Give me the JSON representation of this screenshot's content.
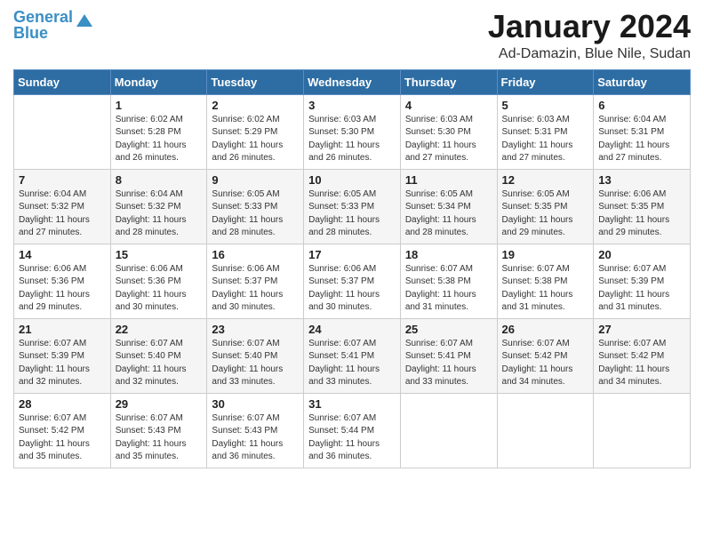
{
  "logo": {
    "line1": "General",
    "line2": "Blue"
  },
  "header": {
    "month": "January 2024",
    "location": "Ad-Damazin, Blue Nile, Sudan"
  },
  "weekdays": [
    "Sunday",
    "Monday",
    "Tuesday",
    "Wednesday",
    "Thursday",
    "Friday",
    "Saturday"
  ],
  "weeks": [
    [
      {
        "day": "",
        "info": ""
      },
      {
        "day": "1",
        "info": "Sunrise: 6:02 AM\nSunset: 5:28 PM\nDaylight: 11 hours\nand 26 minutes."
      },
      {
        "day": "2",
        "info": "Sunrise: 6:02 AM\nSunset: 5:29 PM\nDaylight: 11 hours\nand 26 minutes."
      },
      {
        "day": "3",
        "info": "Sunrise: 6:03 AM\nSunset: 5:30 PM\nDaylight: 11 hours\nand 26 minutes."
      },
      {
        "day": "4",
        "info": "Sunrise: 6:03 AM\nSunset: 5:30 PM\nDaylight: 11 hours\nand 27 minutes."
      },
      {
        "day": "5",
        "info": "Sunrise: 6:03 AM\nSunset: 5:31 PM\nDaylight: 11 hours\nand 27 minutes."
      },
      {
        "day": "6",
        "info": "Sunrise: 6:04 AM\nSunset: 5:31 PM\nDaylight: 11 hours\nand 27 minutes."
      }
    ],
    [
      {
        "day": "7",
        "info": "Sunrise: 6:04 AM\nSunset: 5:32 PM\nDaylight: 11 hours\nand 27 minutes."
      },
      {
        "day": "8",
        "info": "Sunrise: 6:04 AM\nSunset: 5:32 PM\nDaylight: 11 hours\nand 28 minutes."
      },
      {
        "day": "9",
        "info": "Sunrise: 6:05 AM\nSunset: 5:33 PM\nDaylight: 11 hours\nand 28 minutes."
      },
      {
        "day": "10",
        "info": "Sunrise: 6:05 AM\nSunset: 5:33 PM\nDaylight: 11 hours\nand 28 minutes."
      },
      {
        "day": "11",
        "info": "Sunrise: 6:05 AM\nSunset: 5:34 PM\nDaylight: 11 hours\nand 28 minutes."
      },
      {
        "day": "12",
        "info": "Sunrise: 6:05 AM\nSunset: 5:35 PM\nDaylight: 11 hours\nand 29 minutes."
      },
      {
        "day": "13",
        "info": "Sunrise: 6:06 AM\nSunset: 5:35 PM\nDaylight: 11 hours\nand 29 minutes."
      }
    ],
    [
      {
        "day": "14",
        "info": "Sunrise: 6:06 AM\nSunset: 5:36 PM\nDaylight: 11 hours\nand 29 minutes."
      },
      {
        "day": "15",
        "info": "Sunrise: 6:06 AM\nSunset: 5:36 PM\nDaylight: 11 hours\nand 30 minutes."
      },
      {
        "day": "16",
        "info": "Sunrise: 6:06 AM\nSunset: 5:37 PM\nDaylight: 11 hours\nand 30 minutes."
      },
      {
        "day": "17",
        "info": "Sunrise: 6:06 AM\nSunset: 5:37 PM\nDaylight: 11 hours\nand 30 minutes."
      },
      {
        "day": "18",
        "info": "Sunrise: 6:07 AM\nSunset: 5:38 PM\nDaylight: 11 hours\nand 31 minutes."
      },
      {
        "day": "19",
        "info": "Sunrise: 6:07 AM\nSunset: 5:38 PM\nDaylight: 11 hours\nand 31 minutes."
      },
      {
        "day": "20",
        "info": "Sunrise: 6:07 AM\nSunset: 5:39 PM\nDaylight: 11 hours\nand 31 minutes."
      }
    ],
    [
      {
        "day": "21",
        "info": "Sunrise: 6:07 AM\nSunset: 5:39 PM\nDaylight: 11 hours\nand 32 minutes."
      },
      {
        "day": "22",
        "info": "Sunrise: 6:07 AM\nSunset: 5:40 PM\nDaylight: 11 hours\nand 32 minutes."
      },
      {
        "day": "23",
        "info": "Sunrise: 6:07 AM\nSunset: 5:40 PM\nDaylight: 11 hours\nand 33 minutes."
      },
      {
        "day": "24",
        "info": "Sunrise: 6:07 AM\nSunset: 5:41 PM\nDaylight: 11 hours\nand 33 minutes."
      },
      {
        "day": "25",
        "info": "Sunrise: 6:07 AM\nSunset: 5:41 PM\nDaylight: 11 hours\nand 33 minutes."
      },
      {
        "day": "26",
        "info": "Sunrise: 6:07 AM\nSunset: 5:42 PM\nDaylight: 11 hours\nand 34 minutes."
      },
      {
        "day": "27",
        "info": "Sunrise: 6:07 AM\nSunset: 5:42 PM\nDaylight: 11 hours\nand 34 minutes."
      }
    ],
    [
      {
        "day": "28",
        "info": "Sunrise: 6:07 AM\nSunset: 5:42 PM\nDaylight: 11 hours\nand 35 minutes."
      },
      {
        "day": "29",
        "info": "Sunrise: 6:07 AM\nSunset: 5:43 PM\nDaylight: 11 hours\nand 35 minutes."
      },
      {
        "day": "30",
        "info": "Sunrise: 6:07 AM\nSunset: 5:43 PM\nDaylight: 11 hours\nand 36 minutes."
      },
      {
        "day": "31",
        "info": "Sunrise: 6:07 AM\nSunset: 5:44 PM\nDaylight: 11 hours\nand 36 minutes."
      },
      {
        "day": "",
        "info": ""
      },
      {
        "day": "",
        "info": ""
      },
      {
        "day": "",
        "info": ""
      }
    ]
  ]
}
